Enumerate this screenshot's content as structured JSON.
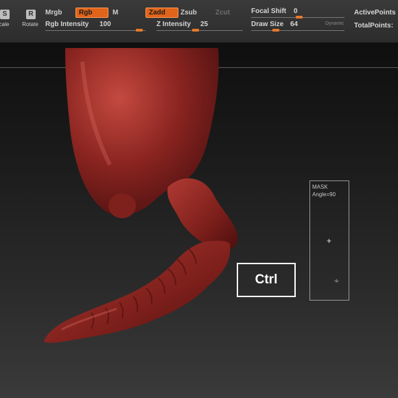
{
  "toolbar": {
    "scale_label": "cale",
    "scale_icon": "S",
    "rotate_label": "Rotate",
    "rotate_icon": "R",
    "mrgb": "Mrgb",
    "rgb": "Rgb",
    "m": "M",
    "zadd": "Zadd",
    "zsub": "Zsub",
    "zcut": "Zcut",
    "rgb_intensity_label": "Rgb Intensity",
    "rgb_intensity_value": "100",
    "z_intensity_label": "Z Intensity",
    "z_intensity_value": "25",
    "focal_shift_label": "Focal Shift",
    "focal_shift_value": "0",
    "draw_size_label": "Draw Size",
    "draw_size_value": "64",
    "dynamic": "Dynamic",
    "active_points": "ActivePoints",
    "total_points": "TotalPoints:"
  },
  "overlay": {
    "ctrl_key": "Ctrl"
  },
  "mask_panel": {
    "title": "MASK",
    "angle": "Angle=90"
  },
  "colors": {
    "accent": "#e0641a",
    "model": "#8a2420"
  }
}
